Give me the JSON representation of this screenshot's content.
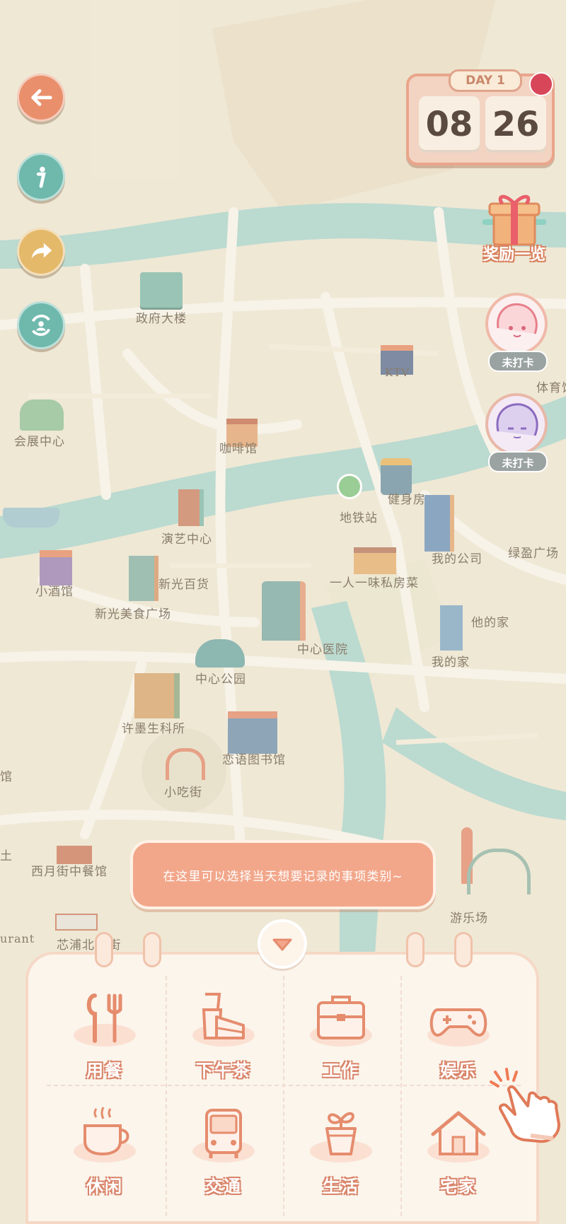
{
  "clock": {
    "day_label": "DAY 1",
    "hour": "08",
    "minute": "26"
  },
  "reward": {
    "label": "奖励一览"
  },
  "checkins": [
    {
      "status": "未打卡",
      "avatar": "girl-avatar-icon"
    },
    {
      "status": "未打卡",
      "avatar": "boy-avatar-icon"
    }
  ],
  "places": {
    "gov": "政府大楼",
    "ktv": "KTV",
    "sports": "体育馆",
    "expo": "会展中心",
    "cafe": "咖啡馆",
    "metro": "地铁站",
    "gym": "健身房",
    "theater": "演艺中心",
    "green": "绿盈广场",
    "mycompany": "我的公司",
    "bar": "小酒馆",
    "mall": "新光百货",
    "privatekitchen": "一人一味私房菜",
    "foodplaza": "新光美食广场",
    "hospital": "中心医院",
    "hishome": "他的家",
    "myhome": "我的家",
    "park": "中心公园",
    "lab": "许墨生科所",
    "library": "恋语图书馆",
    "snackstreet": "小吃街",
    "westmoon": "西月街中餐馆",
    "amusement": "游乐场",
    "restaurant": "urant",
    "flowerstreet": "芯浦北...街",
    "left1": "馆",
    "left2": "土"
  },
  "hint": "在这里可以选择当天想要记录的事项类别~",
  "categories": [
    {
      "label": "用餐",
      "icon": "fork-spoon-icon"
    },
    {
      "label": "下午茶",
      "icon": "cake-icon"
    },
    {
      "label": "工作",
      "icon": "briefcase-icon"
    },
    {
      "label": "娱乐",
      "icon": "gamepad-icon"
    },
    {
      "label": "休闲",
      "icon": "coffee-cup-icon"
    },
    {
      "label": "交通",
      "icon": "bus-icon"
    },
    {
      "label": "生活",
      "icon": "potted-plant-icon"
    },
    {
      "label": "宅家",
      "icon": "house-icon"
    }
  ],
  "colors": {
    "accent": "#f2a78b",
    "river": "#a9d3c8",
    "land": "#ece5cf"
  }
}
